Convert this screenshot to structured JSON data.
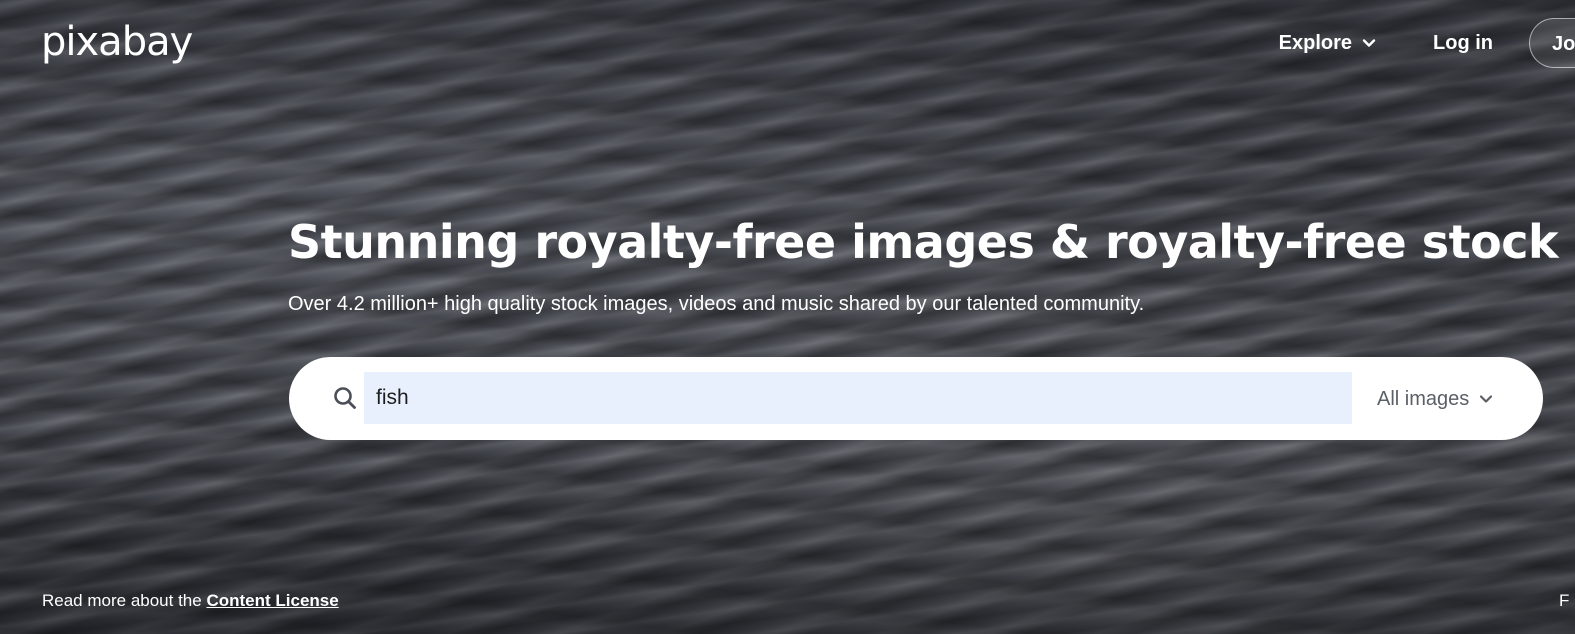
{
  "header": {
    "logo_text": "pixabay",
    "nav": {
      "explore_label": "Explore",
      "login_label": "Log in",
      "join_label": "Jo"
    }
  },
  "hero": {
    "headline": "Stunning royalty-free images & royalty-free stock",
    "subheadline": "Over 4.2 million+ high quality stock images, videos and music shared by our talented community."
  },
  "search": {
    "value": "fish",
    "type_label": "All images"
  },
  "footer": {
    "license_prefix": "Read more about the ",
    "license_link": "Content License",
    "right_text": "F"
  },
  "icons": {
    "search": "search-icon",
    "explore_chevron": "chevron-down-icon",
    "type_chevron": "chevron-down-icon"
  }
}
